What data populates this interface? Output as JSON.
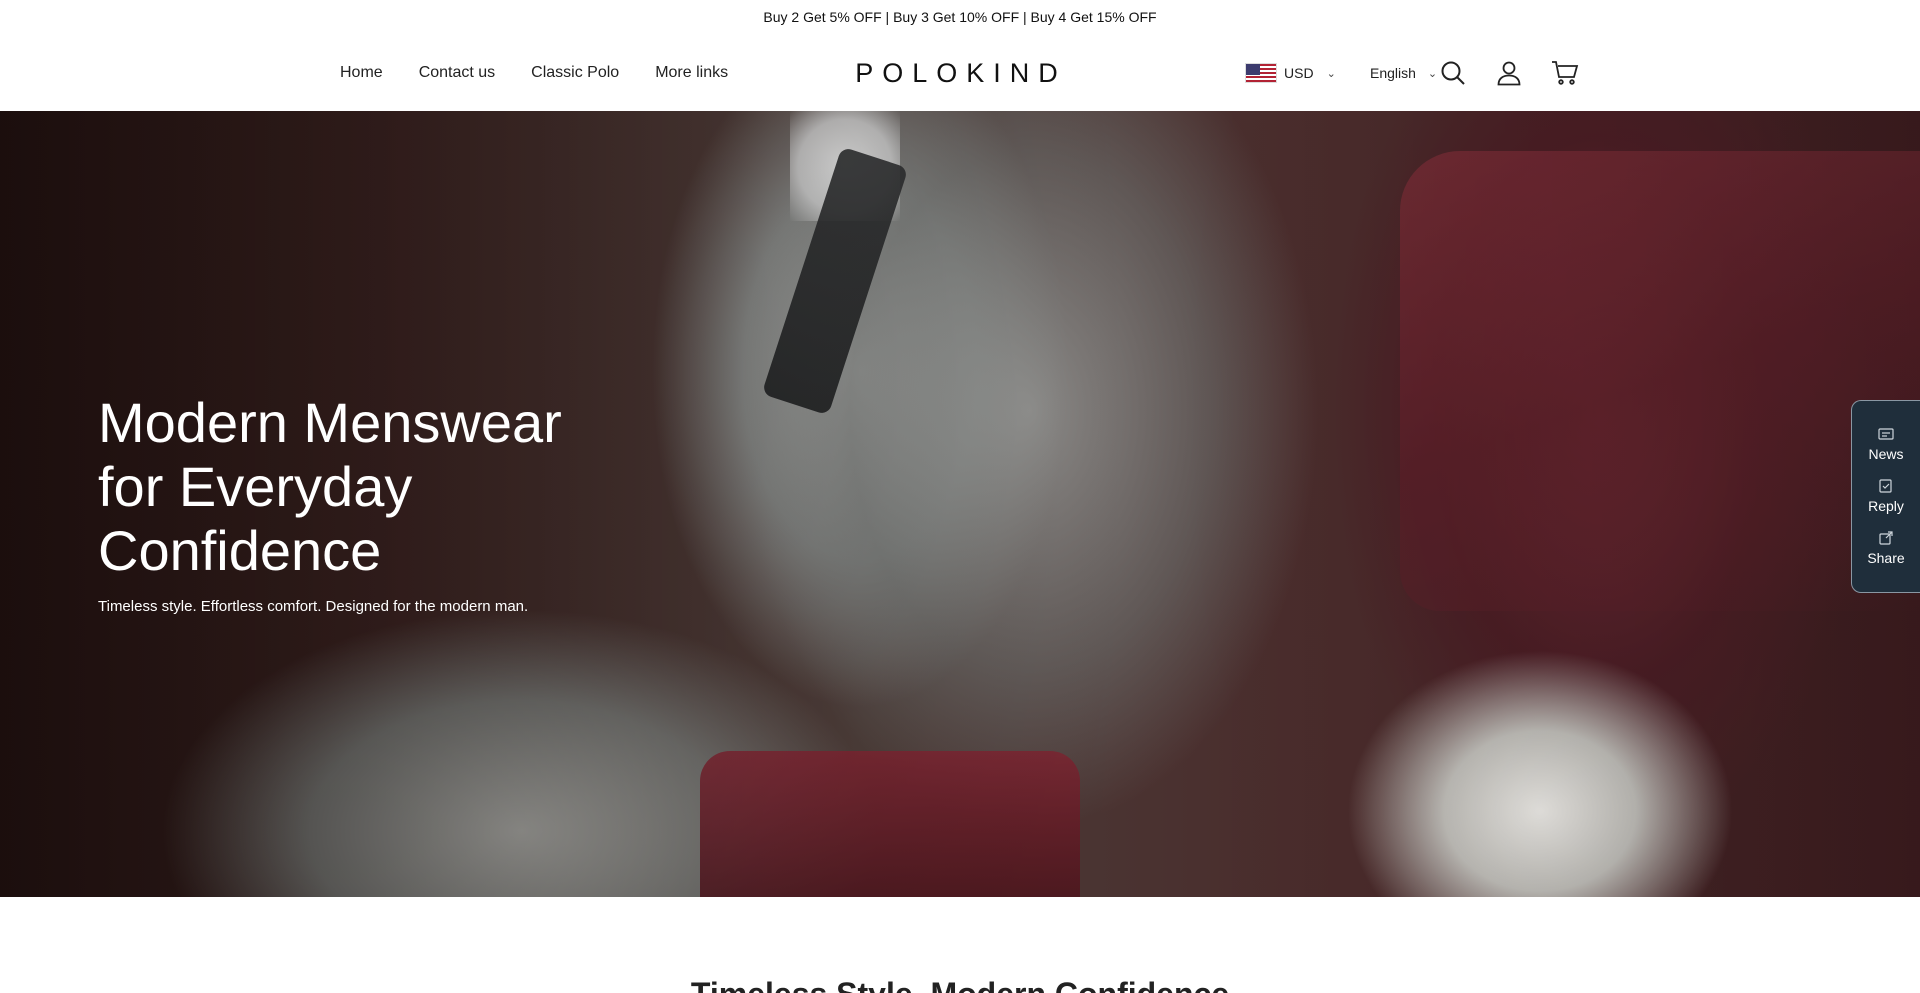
{
  "announcement": "Buy 2 Get 5% OFF | Buy 3 Get 10% OFF | Buy 4 Get 15% OFF",
  "nav": {
    "items": [
      {
        "label": "Home"
      },
      {
        "label": "Contact us"
      },
      {
        "label": "Classic Polo"
      },
      {
        "label": "More links"
      }
    ]
  },
  "brand": {
    "logo_text": "POLOKIND"
  },
  "header": {
    "currency": "USD",
    "language": "English",
    "icons": [
      "search-icon",
      "account-icon",
      "cart-icon"
    ]
  },
  "hero": {
    "title": "Modern Menswear for Everyday Confidence",
    "subtitle": "Timeless style. Effortless comfort. Designed for the modern man."
  },
  "side_widget": {
    "items": [
      {
        "label": "News",
        "icon": "news-icon"
      },
      {
        "label": "Reply",
        "icon": "reply-icon"
      },
      {
        "label": "Share",
        "icon": "share-icon"
      }
    ]
  },
  "section": {
    "title": "Timeless Style, Modern Confidence"
  },
  "colors": {
    "widget_bg": "#1f2e3b",
    "text_dark": "#222222",
    "hero_text": "#ffffff"
  }
}
